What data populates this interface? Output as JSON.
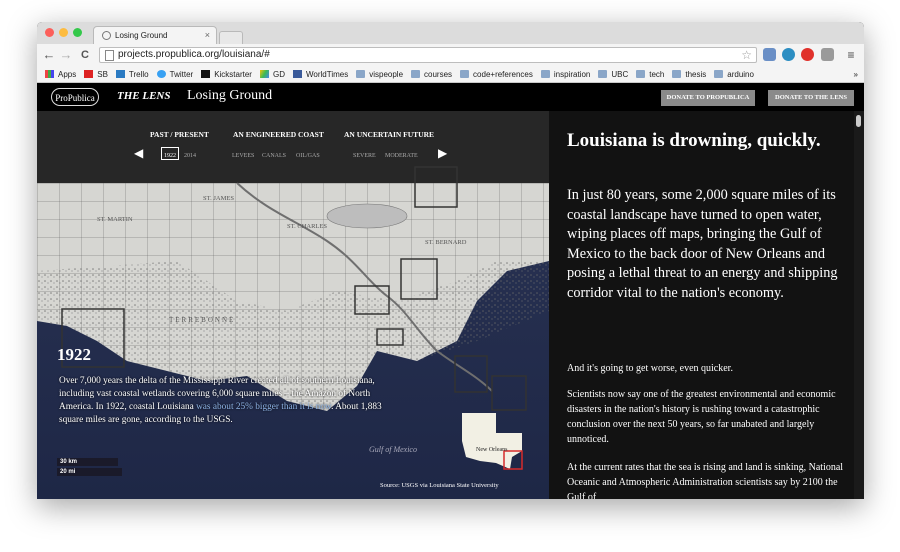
{
  "browser": {
    "tab_title": "Losing Ground",
    "tab_close": "×",
    "url": "projects.propublica.org/louisiana/#",
    "nav_back": "←",
    "nav_forward": "→",
    "nav_reload": "C",
    "star": "☆",
    "menu": "≡",
    "bookmarks": [
      "Apps",
      "SB",
      "Trello",
      "Twitter",
      "Kickstarter",
      "GD",
      "WorldTimes",
      "vispeople",
      "courses",
      "code+references",
      "inspiration",
      "UBC",
      "tech",
      "thesis",
      "arduino"
    ],
    "bookmarks_more": "»"
  },
  "site": {
    "logo_propublica": "ProPublica",
    "logo_lens": "THE LENS",
    "title": "Losing Ground",
    "donate_propublica": "DONATE TO PROPUBLICA",
    "donate_lens": "DONATE TO THE LENS"
  },
  "map_nav": {
    "prev": "◀",
    "next": "▶",
    "categories": [
      "PAST / PRESENT",
      "AN ENGINEERED COAST",
      "AN UNCERTAIN FUTURE"
    ],
    "past_options": [
      "1922",
      "2014"
    ],
    "coast_options": [
      "LEVEES",
      "CANALS",
      "OIL/GAS"
    ],
    "future_options": [
      "SEVERE",
      "MODERATE"
    ],
    "selected_year": "1922"
  },
  "map": {
    "year": "1922",
    "text_before": "Over 7,000 years the delta of the Mississippi River created all of southern Louisiana, including vast coastal wetlands covering 6,000 square miles – the Amazon of North America. In 1922, coastal Louisiana ",
    "text_link": "was about 25% bigger than it is now",
    "text_after": ". About 1,883 square miles are gone, according to the USGS.",
    "scale_km": "30 km",
    "scale_mi": "20 mi",
    "gulf_label": "Gulf of Mexico",
    "inset_label": "New Orleans",
    "source": "Source: USGS via Louisiana State University",
    "place_labels": [
      "ST. JAMES",
      "ST. CHARLES",
      "ST. BERNARD",
      "TERREBONNE",
      "ST. MARTIN"
    ]
  },
  "article": {
    "headline": "Louisiana is drowning, quickly.",
    "lead": "In just 80 years, some 2,000 square miles of its coastal landscape have turned to open water, wiping places off maps, bringing the Gulf of Mexico to the back door of New Orleans and posing a lethal threat to an energy and shipping corridor vital to the nation's economy.",
    "p1": "And it's going to get worse, even quicker.",
    "p2": "Scientists now say one of the greatest environmental and economic disasters in the nation's history is rushing toward a catastrophic conclusion over the next 50 years, so far unabated and largely unnoticed.",
    "p3": "At the current rates that the sea is rising and land is sinking, National Oceanic and Atmospheric Administration scientists say by 2100 the Gulf of"
  },
  "colors": {
    "accent_red": "#d62b2b",
    "link_blue": "#8fb4e6",
    "donate_gray": "#8a8a8a"
  }
}
